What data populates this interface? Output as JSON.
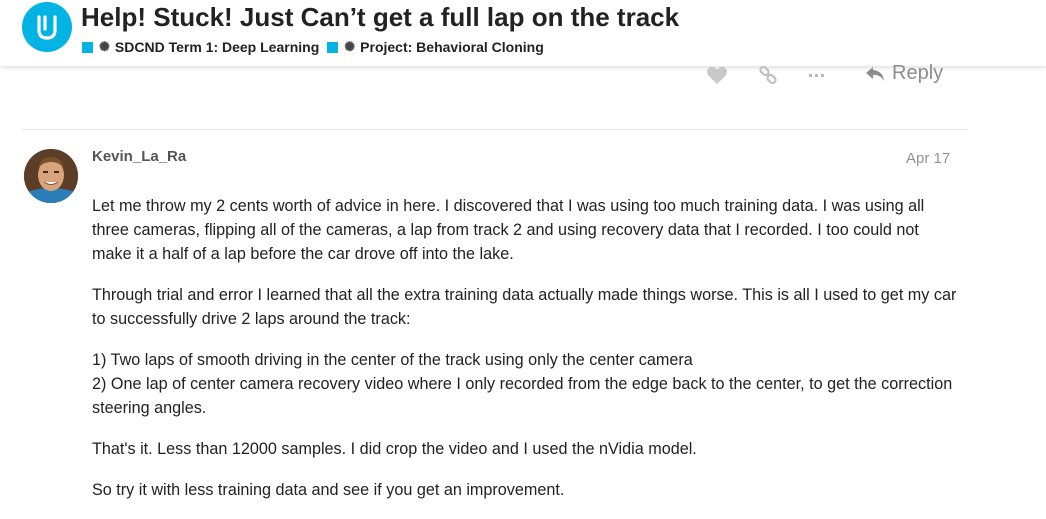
{
  "topic": {
    "title": "Help! Stuck! Just Can’t get a full lap on the track",
    "categories": [
      {
        "label": "SDCND Term 1: Deep Learning",
        "color": "#02b3e4",
        "icon": "lock-icon"
      },
      {
        "label": "Project: Behavioral Cloning",
        "color": "#02b3e4",
        "icon": "lock-icon"
      }
    ]
  },
  "actions": {
    "like_icon": "heart-icon",
    "link_icon": "link-icon",
    "more_icon": "ellipsis-icon",
    "reply_icon": "reply-arrow-icon",
    "reply_label": "Reply"
  },
  "post": {
    "username": "Kevin_La_Ra",
    "date": "Apr 17",
    "paragraphs": [
      "Let me throw my 2 cents worth of advice in here. I discovered that I was using too much training data. I was using all three cameras, flipping all of the cameras, a lap from track 2 and using recovery data that I recorded. I too could not make it a half of a lap before the car drove off into the lake.",
      "Through trial and error I learned that all the extra training data actually made things worse. This is all I used to get my car to successfully drive 2 laps around the track:",
      "1) Two laps of smooth driving in the center of the track using only the center camera",
      "2) One lap of center camera recovery video where I only recorded from the edge back to the center, to get the correction steering angles.",
      "That's it. Less than 12000 samples. I did crop the video and I used the nVidia model.",
      "So try it with less training data and see if you get an improvement."
    ]
  },
  "colors": {
    "brand": "#02b3e4",
    "muted": "#919191"
  }
}
